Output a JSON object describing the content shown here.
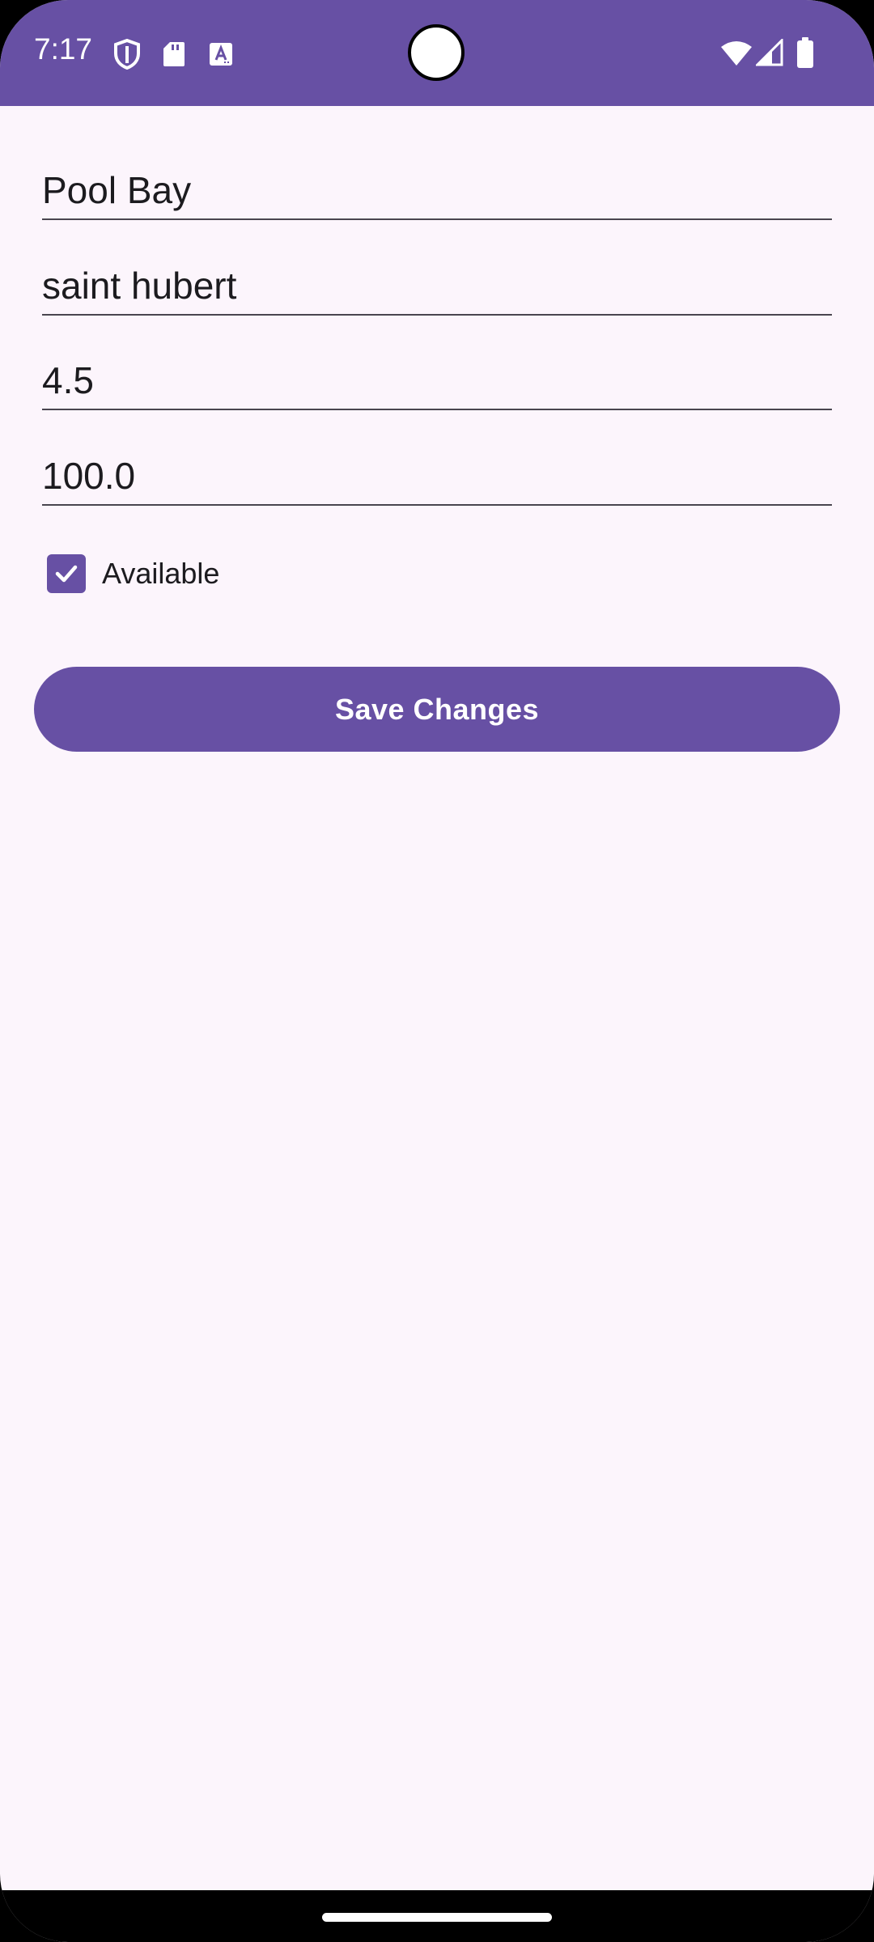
{
  "status_bar": {
    "time": "7:17",
    "background_color": "#6750A4",
    "left_icons": [
      "shield-icon",
      "sd-card-icon",
      "text-a-icon"
    ],
    "right_icons": [
      "wifi-icon",
      "cell-signal-icon",
      "battery-icon"
    ]
  },
  "form": {
    "name_value": "Pool Bay",
    "location_value": "saint hubert",
    "rating_value": "4.5",
    "price_value": "100.0",
    "available_label": "Available",
    "available_checked": true,
    "save_label": "Save Changes"
  },
  "colors": {
    "primary": "#6750A4",
    "background": "#FCF5FC",
    "text": "#1C1B1F"
  }
}
